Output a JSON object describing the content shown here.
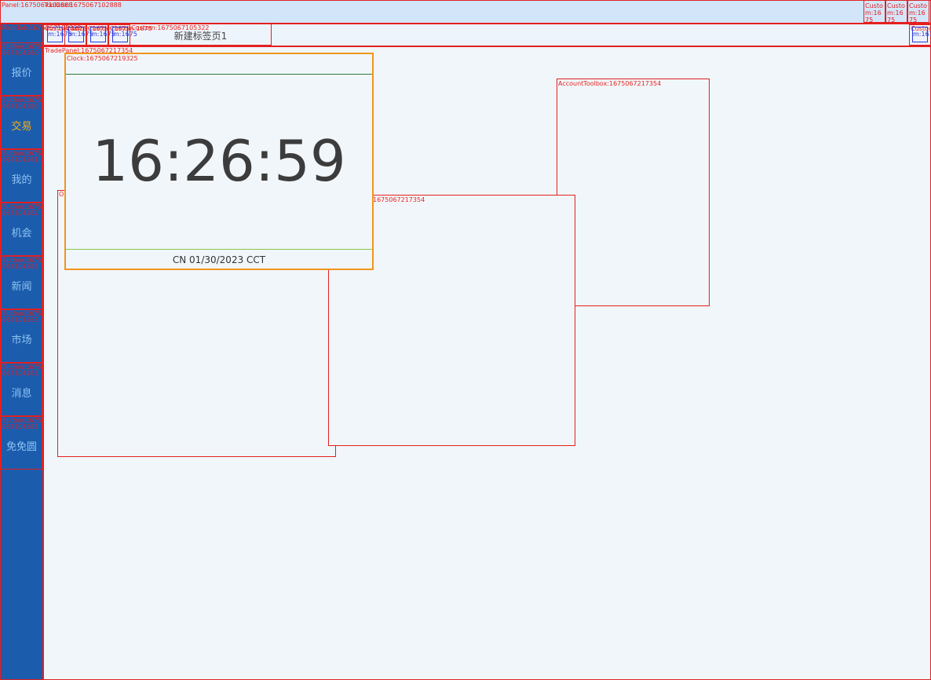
{
  "top": {
    "panel_label": "Panel:1675067102888",
    "toolbox_label": "Toolbox:1675067102888",
    "right_buttons": [
      "Custom:1675",
      "Custom:1675",
      "Custom:1675"
    ]
  },
  "sidebar": {
    "items": [
      {
        "caption": "Button:1675067104260",
        "label": "报价"
      },
      {
        "caption": "Button:1675067104260",
        "label": "交易"
      },
      {
        "caption": "Button:1675067104261",
        "label": "我的"
      },
      {
        "caption": "Button:1675067104262",
        "label": "机会"
      },
      {
        "caption": "Button:1675067104263",
        "label": "新闻"
      },
      {
        "caption": "Button:1675067104263",
        "label": "市场"
      },
      {
        "caption": "Button:1675067104263",
        "label": "消息"
      },
      {
        "caption": "Button:1675067104263",
        "label": "免免圆"
      }
    ]
  },
  "tabs": {
    "main_label": "MainTab:1675067105322",
    "mini_buttons": [
      "Custom:1675",
      "Custom:1675",
      "Custom:1675",
      "Custom:1675"
    ],
    "mini_inner": "m:1675",
    "right_mini_label": "Custom:1675",
    "tab1_caption": "Custom:1675067105322",
    "tab1_label": "新建标签页1"
  },
  "work": {
    "tradepanel_label": "TradePanel:1675067217354",
    "account_toolbox_label": "AccountToolbox:1675067217354",
    "order_panel_label": "1675067217354",
    "left_panel_label": "O"
  },
  "clock": {
    "label": "Clock:1675067219325",
    "time": "16:26:59",
    "date": "CN 01/30/2023 CCT"
  }
}
